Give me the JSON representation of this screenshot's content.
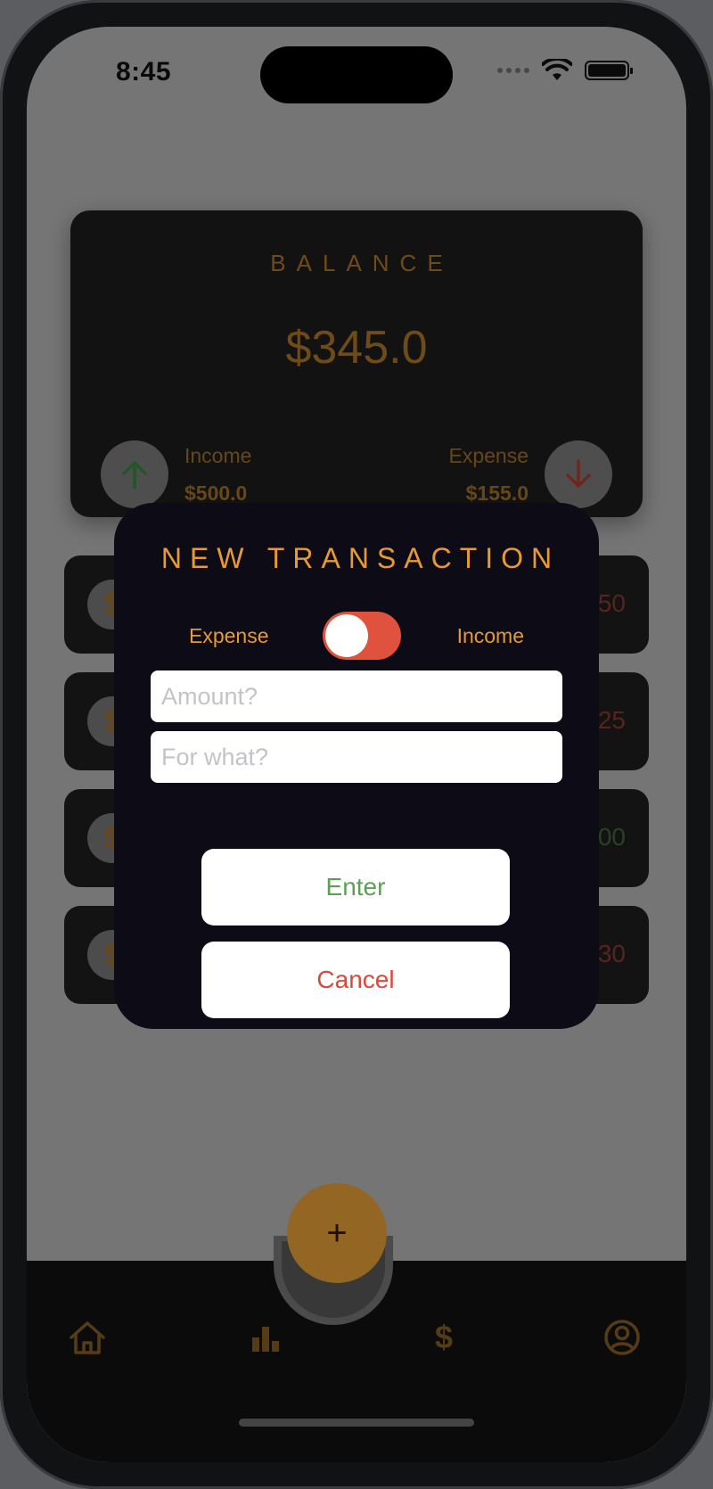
{
  "status_bar": {
    "time": "8:45"
  },
  "balance": {
    "title": "BALANCE",
    "amount": "$345.0",
    "income_label": "Income",
    "income_value": "$500.0",
    "expense_label": "Expense",
    "expense_value": "$155.0"
  },
  "transactions": [
    {
      "icon": "$",
      "amount_fragment": "50",
      "type": "expense"
    },
    {
      "icon": "$",
      "amount_fragment": "25",
      "type": "expense"
    },
    {
      "icon": "$",
      "amount_fragment": "00",
      "type": "income"
    },
    {
      "icon": "$",
      "amount_fragment": "30",
      "type": "expense"
    }
  ],
  "modal": {
    "title": "NEW TRANSACTION",
    "toggle_left_label": "Expense",
    "toggle_right_label": "Income",
    "amount_placeholder": "Amount?",
    "description_placeholder": "For what?",
    "enter_label": "Enter",
    "cancel_label": "Cancel"
  },
  "fab": {
    "label": "+"
  },
  "bottom_nav": {
    "money_label": "$",
    "icons": [
      "home-icon",
      "bar-chart-icon",
      "dollar-icon",
      "profile-icon"
    ]
  },
  "colors": {
    "accent": "#e69a33",
    "income": "#5aa153",
    "expense": "#e0513e",
    "modal_bg": "#0d0b16",
    "card_bg": "#1d1d1f"
  }
}
